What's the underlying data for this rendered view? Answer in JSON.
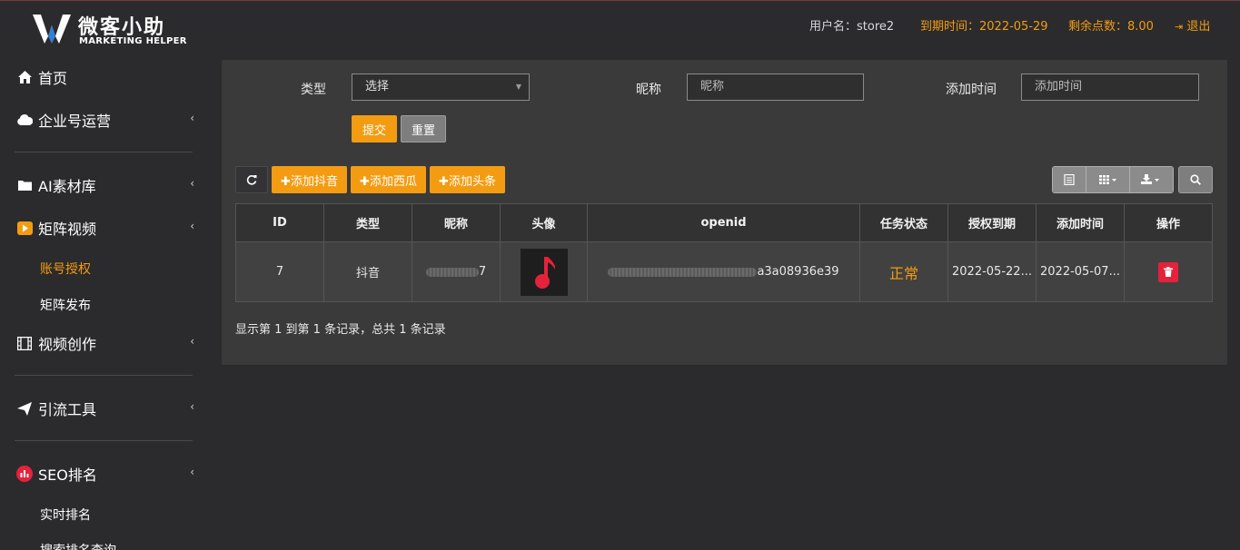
{
  "header": {
    "logo_cn": "微客小助",
    "logo_en": "MARKETING HELPER",
    "username": "用户名：store2",
    "expire": "到期时间：2022-05-29",
    "points": "剩余点数：8.00",
    "logout": "退出"
  },
  "sidebar": {
    "items": [
      {
        "label": "首页",
        "icon": "home-icon"
      },
      {
        "label": "企业号运营",
        "icon": "cloud-icon"
      },
      {
        "label": "AI素材库",
        "icon": "folder-icon"
      },
      {
        "label": "矩阵视频",
        "icon": "video-icon"
      },
      {
        "label": "视频创作",
        "icon": "film-icon"
      },
      {
        "label": "引流工具",
        "icon": "send-icon"
      },
      {
        "label": "SEO排名",
        "icon": "chart-icon"
      }
    ],
    "sub_matrix": [
      "账号授权",
      "矩阵发布"
    ],
    "sub_seo": [
      "实时排名",
      "搜索排名查询"
    ]
  },
  "filters": {
    "type_label": "类型",
    "type_value": "选择",
    "nickname_label": "昵称",
    "nickname_placeholder": "昵称",
    "time_label": "添加时间",
    "time_placeholder": "添加时间",
    "submit": "提交",
    "reset": "重置"
  },
  "toolbar": {
    "add_douyin": "✚添加抖音",
    "add_xigua": "✚添加西瓜",
    "add_toutiao": "✚添加头条"
  },
  "table": {
    "headers": [
      "ID",
      "类型",
      "昵称",
      "头像",
      "openid",
      "任务状态",
      "授权到期",
      "添加时间",
      "操作"
    ],
    "rows": [
      {
        "id": "7",
        "type": "抖音",
        "nickname_tail": "7",
        "openid_tail": "a3a08936e39",
        "status": "正常",
        "auth_expire": "2022-05-22...",
        "added": "2022-05-07..."
      }
    ],
    "summary": "显示第 1 到第 1 条记录，总共 1 条记录"
  },
  "colors": {
    "accent": "#f39c12",
    "danger": "#e5223c",
    "background": "#2b2b2d",
    "panel": "#3a3a3a"
  }
}
